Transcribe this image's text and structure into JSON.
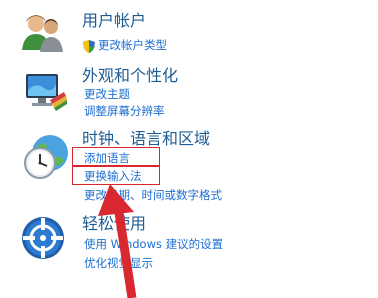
{
  "categories": [
    {
      "title": "用户帐户",
      "icon": "users-icon",
      "links": [
        "更改帐户类型"
      ]
    },
    {
      "title": "外观和个性化",
      "icon": "appearance-icon",
      "links": [
        "更改主题",
        "调整屏幕分辨率"
      ]
    },
    {
      "title": "时钟、语言和区域",
      "icon": "clock-globe-icon",
      "links": [
        "添加语言",
        "更换输入法",
        "更改日期、时间或数字格式"
      ]
    },
    {
      "title": "轻松使用",
      "icon": "ease-of-access-icon",
      "links": [
        "使用 Windows 建议的设置",
        "优化视觉显示"
      ]
    }
  ],
  "annotation_color": "#d9282f",
  "link_color": "#1d6fd1",
  "title_color": "#1e5c94"
}
